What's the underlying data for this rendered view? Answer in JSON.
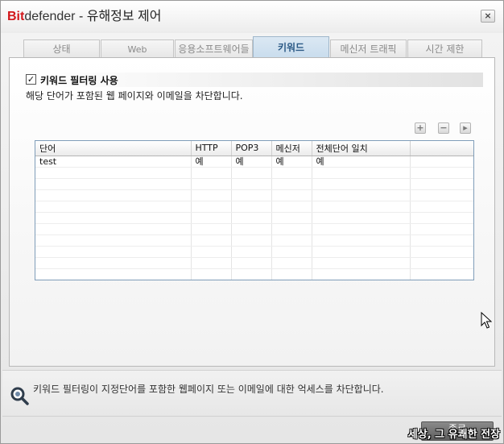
{
  "window": {
    "brand_bit": "Bit",
    "brand_def": "defender",
    "title": " - 유해정보 제어",
    "close_symbol": "×"
  },
  "tabs": [
    {
      "label": "상태",
      "active": false
    },
    {
      "label": "Web",
      "active": false
    },
    {
      "label": "응용소프트웨어들",
      "active": false
    },
    {
      "label": "키워드",
      "active": true
    },
    {
      "label": "메신저 트래픽",
      "active": false
    },
    {
      "label": "시간 제한",
      "active": false
    }
  ],
  "keyword_filter": {
    "enabled": true,
    "check_symbol": "✓",
    "label": "키워드 필터링 사용",
    "description": "해당 단어가 포함된 웹 페이지와 이메일을 차단합니다."
  },
  "toolbar": {
    "add_symbol": "+",
    "remove_symbol": "−",
    "edit_symbol": "▸"
  },
  "table": {
    "columns": [
      "단어",
      "HTTP",
      "POP3",
      "메신저",
      "전체단어 일치",
      ""
    ],
    "rows": [
      [
        "test",
        "예",
        "예",
        "예",
        "예",
        ""
      ]
    ]
  },
  "hint": {
    "text": "키워드 필터링이 지정단어를 포함한 웹페이지 또는 이메일에 대한 억세스를 차단합니다."
  },
  "footer": {
    "close_label": "종료",
    "watermark": "세상, 그 유쾌한 전장"
  },
  "colors": {
    "brand_red": "#d2171b",
    "active_tab_text": "#2b5a86",
    "grid_border": "#7f9db9"
  }
}
